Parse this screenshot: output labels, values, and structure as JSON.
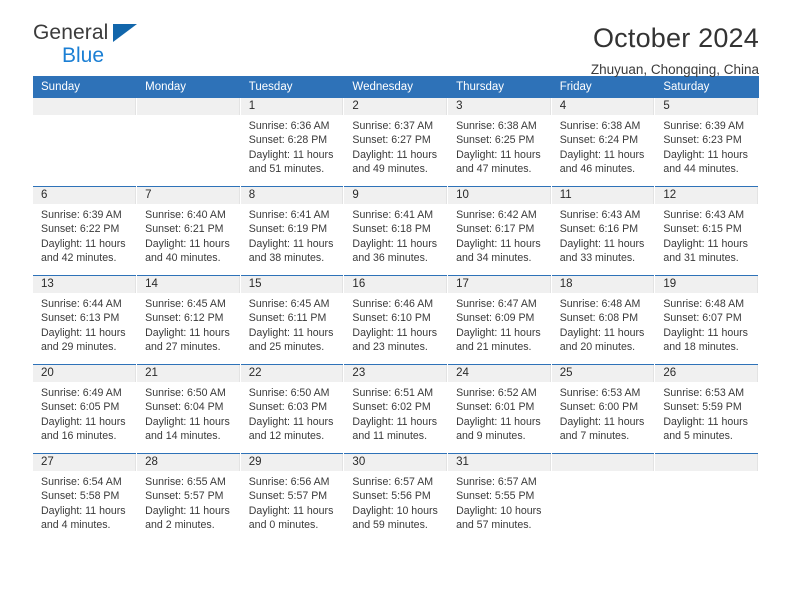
{
  "brand": {
    "general": "General",
    "blue": "Blue",
    "triangle_icon": "triangle-icon"
  },
  "header": {
    "title": "October 2024",
    "location": "Zhuyuan, Chongqing, China"
  },
  "colors": {
    "header_blue": "#2e72b8",
    "brand_blue": "#1b7fd4",
    "daynum_bg": "#f0f0f0"
  },
  "weekdays": [
    "Sunday",
    "Monday",
    "Tuesday",
    "Wednesday",
    "Thursday",
    "Friday",
    "Saturday"
  ],
  "weeks": [
    [
      {
        "day": "",
        "empty": true
      },
      {
        "day": "",
        "empty": true
      },
      {
        "day": "1",
        "sunrise": "Sunrise: 6:36 AM",
        "sunset": "Sunset: 6:28 PM",
        "daylight": "Daylight: 11 hours and 51 minutes."
      },
      {
        "day": "2",
        "sunrise": "Sunrise: 6:37 AM",
        "sunset": "Sunset: 6:27 PM",
        "daylight": "Daylight: 11 hours and 49 minutes."
      },
      {
        "day": "3",
        "sunrise": "Sunrise: 6:38 AM",
        "sunset": "Sunset: 6:25 PM",
        "daylight": "Daylight: 11 hours and 47 minutes."
      },
      {
        "day": "4",
        "sunrise": "Sunrise: 6:38 AM",
        "sunset": "Sunset: 6:24 PM",
        "daylight": "Daylight: 11 hours and 46 minutes."
      },
      {
        "day": "5",
        "sunrise": "Sunrise: 6:39 AM",
        "sunset": "Sunset: 6:23 PM",
        "daylight": "Daylight: 11 hours and 44 minutes."
      }
    ],
    [
      {
        "day": "6",
        "sunrise": "Sunrise: 6:39 AM",
        "sunset": "Sunset: 6:22 PM",
        "daylight": "Daylight: 11 hours and 42 minutes."
      },
      {
        "day": "7",
        "sunrise": "Sunrise: 6:40 AM",
        "sunset": "Sunset: 6:21 PM",
        "daylight": "Daylight: 11 hours and 40 minutes."
      },
      {
        "day": "8",
        "sunrise": "Sunrise: 6:41 AM",
        "sunset": "Sunset: 6:19 PM",
        "daylight": "Daylight: 11 hours and 38 minutes."
      },
      {
        "day": "9",
        "sunrise": "Sunrise: 6:41 AM",
        "sunset": "Sunset: 6:18 PM",
        "daylight": "Daylight: 11 hours and 36 minutes."
      },
      {
        "day": "10",
        "sunrise": "Sunrise: 6:42 AM",
        "sunset": "Sunset: 6:17 PM",
        "daylight": "Daylight: 11 hours and 34 minutes."
      },
      {
        "day": "11",
        "sunrise": "Sunrise: 6:43 AM",
        "sunset": "Sunset: 6:16 PM",
        "daylight": "Daylight: 11 hours and 33 minutes."
      },
      {
        "day": "12",
        "sunrise": "Sunrise: 6:43 AM",
        "sunset": "Sunset: 6:15 PM",
        "daylight": "Daylight: 11 hours and 31 minutes."
      }
    ],
    [
      {
        "day": "13",
        "sunrise": "Sunrise: 6:44 AM",
        "sunset": "Sunset: 6:13 PM",
        "daylight": "Daylight: 11 hours and 29 minutes."
      },
      {
        "day": "14",
        "sunrise": "Sunrise: 6:45 AM",
        "sunset": "Sunset: 6:12 PM",
        "daylight": "Daylight: 11 hours and 27 minutes."
      },
      {
        "day": "15",
        "sunrise": "Sunrise: 6:45 AM",
        "sunset": "Sunset: 6:11 PM",
        "daylight": "Daylight: 11 hours and 25 minutes."
      },
      {
        "day": "16",
        "sunrise": "Sunrise: 6:46 AM",
        "sunset": "Sunset: 6:10 PM",
        "daylight": "Daylight: 11 hours and 23 minutes."
      },
      {
        "day": "17",
        "sunrise": "Sunrise: 6:47 AM",
        "sunset": "Sunset: 6:09 PM",
        "daylight": "Daylight: 11 hours and 21 minutes."
      },
      {
        "day": "18",
        "sunrise": "Sunrise: 6:48 AM",
        "sunset": "Sunset: 6:08 PM",
        "daylight": "Daylight: 11 hours and 20 minutes."
      },
      {
        "day": "19",
        "sunrise": "Sunrise: 6:48 AM",
        "sunset": "Sunset: 6:07 PM",
        "daylight": "Daylight: 11 hours and 18 minutes."
      }
    ],
    [
      {
        "day": "20",
        "sunrise": "Sunrise: 6:49 AM",
        "sunset": "Sunset: 6:05 PM",
        "daylight": "Daylight: 11 hours and 16 minutes."
      },
      {
        "day": "21",
        "sunrise": "Sunrise: 6:50 AM",
        "sunset": "Sunset: 6:04 PM",
        "daylight": "Daylight: 11 hours and 14 minutes."
      },
      {
        "day": "22",
        "sunrise": "Sunrise: 6:50 AM",
        "sunset": "Sunset: 6:03 PM",
        "daylight": "Daylight: 11 hours and 12 minutes."
      },
      {
        "day": "23",
        "sunrise": "Sunrise: 6:51 AM",
        "sunset": "Sunset: 6:02 PM",
        "daylight": "Daylight: 11 hours and 11 minutes."
      },
      {
        "day": "24",
        "sunrise": "Sunrise: 6:52 AM",
        "sunset": "Sunset: 6:01 PM",
        "daylight": "Daylight: 11 hours and 9 minutes."
      },
      {
        "day": "25",
        "sunrise": "Sunrise: 6:53 AM",
        "sunset": "Sunset: 6:00 PM",
        "daylight": "Daylight: 11 hours and 7 minutes."
      },
      {
        "day": "26",
        "sunrise": "Sunrise: 6:53 AM",
        "sunset": "Sunset: 5:59 PM",
        "daylight": "Daylight: 11 hours and 5 minutes."
      }
    ],
    [
      {
        "day": "27",
        "sunrise": "Sunrise: 6:54 AM",
        "sunset": "Sunset: 5:58 PM",
        "daylight": "Daylight: 11 hours and 4 minutes."
      },
      {
        "day": "28",
        "sunrise": "Sunrise: 6:55 AM",
        "sunset": "Sunset: 5:57 PM",
        "daylight": "Daylight: 11 hours and 2 minutes."
      },
      {
        "day": "29",
        "sunrise": "Sunrise: 6:56 AM",
        "sunset": "Sunset: 5:57 PM",
        "daylight": "Daylight: 11 hours and 0 minutes."
      },
      {
        "day": "30",
        "sunrise": "Sunrise: 6:57 AM",
        "sunset": "Sunset: 5:56 PM",
        "daylight": "Daylight: 10 hours and 59 minutes."
      },
      {
        "day": "31",
        "sunrise": "Sunrise: 6:57 AM",
        "sunset": "Sunset: 5:55 PM",
        "daylight": "Daylight: 10 hours and 57 minutes."
      },
      {
        "day": "",
        "empty": true
      },
      {
        "day": "",
        "empty": true
      }
    ]
  ]
}
